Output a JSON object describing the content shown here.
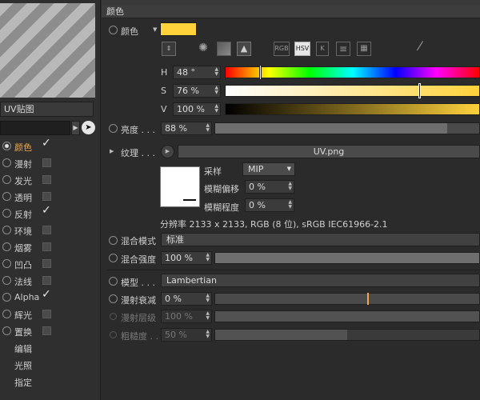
{
  "left": {
    "material_name": "UV贴图",
    "channels": [
      {
        "label": "颜色",
        "active": true,
        "checked": true,
        "selected": true
      },
      {
        "label": "漫射",
        "active": false,
        "checked": false,
        "selected": false
      },
      {
        "label": "发光",
        "active": false,
        "checked": false,
        "selected": false
      },
      {
        "label": "透明",
        "active": false,
        "checked": false,
        "selected": false
      },
      {
        "label": "反射",
        "active": false,
        "checked": true,
        "selected": false
      },
      {
        "label": "环境",
        "active": false,
        "checked": false,
        "selected": false
      },
      {
        "label": "烟雾",
        "active": false,
        "checked": false,
        "selected": false
      },
      {
        "label": "凹凸",
        "active": false,
        "checked": false,
        "selected": false
      },
      {
        "label": "法线",
        "active": false,
        "checked": false,
        "selected": false
      },
      {
        "label": "Alpha",
        "active": false,
        "checked": true,
        "selected": false
      },
      {
        "label": "辉光",
        "active": false,
        "checked": false,
        "selected": false
      },
      {
        "label": "置换",
        "active": false,
        "checked": false,
        "selected": false
      }
    ],
    "extra_items": [
      "编辑",
      "光照",
      "指定"
    ]
  },
  "header": {
    "title": "颜色"
  },
  "color": {
    "label": "颜色",
    "swatch": "#ffd23c",
    "mode_buttons": [
      "RGB",
      "HSV",
      "K"
    ],
    "active_mode": "HSV",
    "h_label": "H",
    "h_value": "48 °",
    "h_fraction": 0.133,
    "s_label": "S",
    "s_value": "76 %",
    "s_fraction": 0.76,
    "v_label": "V",
    "v_value": "100 %",
    "v_fraction": 1.0
  },
  "brightness": {
    "label": "亮度 . . .",
    "value": "88 %",
    "fraction": 0.88
  },
  "texture": {
    "label": "纹理 . . .",
    "file": "UV.png",
    "sampling_label": "采样",
    "sampling_value": "MIP",
    "blur_offset_label": "模糊偏移",
    "blur_offset_value": "0 %",
    "blur_scale_label": "模糊程度",
    "blur_scale_value": "0 %",
    "info": "分辨率 2133 x 2133, RGB (8 位), sRGB IEC61966-2.1"
  },
  "blend_mode": {
    "label": "混合模式",
    "value": "标准"
  },
  "blend_strength": {
    "label": "混合强度",
    "value": "100 %",
    "fraction": 1.0
  },
  "model": {
    "label": "模型 . . .",
    "value": "Lambertian"
  },
  "diffuse_falloff": {
    "label": "漫射衰减",
    "value": "0 %",
    "fraction": 0.0
  },
  "diffuse_level": {
    "label": "漫射层级",
    "value": "100 %",
    "fraction": 1.0
  },
  "roughness": {
    "label": "粗糙度 . .",
    "value": "50 %",
    "fraction": 0.5
  }
}
